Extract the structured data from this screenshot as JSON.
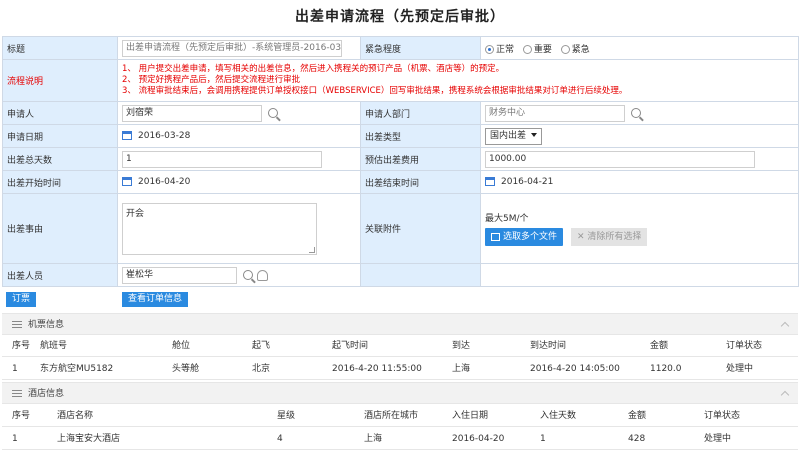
{
  "page_title": "出差申请流程（先预定后审批）",
  "form": {
    "title_label": "标题",
    "title_value": "出差申请流程（先预定后审批）-系统管理员-2016-03-",
    "urgency_label": "紧急程度",
    "urgency_options": [
      "正常",
      "重要",
      "紧急"
    ],
    "urgency_selected": "正常",
    "flow_label": "流程说明",
    "flow_lines": [
      "1、 用户提交出差申请，填写相关的出差信息，然后进入携程关的预订产品（机票、酒店等）的预定。",
      "2、 预定好携程产品后，然后提交流程进行审批",
      "3、 流程审批结束后，会调用携程提供订单授权接口（WEBSERVICE）回写审批结果，携程系统会根据审批结果对订单进行后续处理。"
    ],
    "applicant_label": "申请人",
    "applicant_value": "刘宿荣",
    "dept_label": "申请人部门",
    "dept_value": "财务中心",
    "apply_date_label": "申请日期",
    "apply_date_value": "2016-03-28",
    "trip_type_label": "出差类型",
    "trip_type_value": "国内出差",
    "days_label": "出差总天数",
    "days_value": "1",
    "cost_label": "预估出差费用",
    "cost_value": "1000.00",
    "start_label": "出差开始时间",
    "start_value": "2016-04-20",
    "end_label": "出差结束时间",
    "end_value": "2016-04-21",
    "reason_label": "出差事由",
    "reason_value": "开会",
    "attach_label": "关联附件",
    "attach_max": "最大5M/个",
    "attach_select_btn": "选取多个文件",
    "attach_clear_btn": "清除所有选择",
    "traveler_label": "出差人员",
    "traveler_value": "崔松华"
  },
  "actions": {
    "book": "订票",
    "view_order": "查看订单信息"
  },
  "flight": {
    "section_title": "机票信息",
    "headers": [
      "序号",
      "航班号",
      "舱位",
      "起飞",
      "起飞时间",
      "到达",
      "到达时间",
      "金额",
      "订单状态"
    ],
    "rows": [
      [
        "1",
        "东方航空MU5182",
        "头等舱",
        "北京",
        "2016-4-20 11:55:00",
        "上海",
        "2016-4-20 14:05:00",
        "1120.0",
        "处理中"
      ]
    ]
  },
  "hotel": {
    "section_title": "酒店信息",
    "headers": [
      "序号",
      "酒店名称",
      "星级",
      "酒店所在城市",
      "入住日期",
      "入住天数",
      "金额",
      "订单状态"
    ],
    "rows": [
      [
        "1",
        "上海宝安大酒店",
        "4",
        "上海",
        "2016-04-20",
        "1",
        "428",
        "处理中"
      ]
    ]
  },
  "colors": {
    "label_bg": "#dfeefd",
    "accent_blue": "#2a8ae0",
    "note_red": "#e60000"
  }
}
